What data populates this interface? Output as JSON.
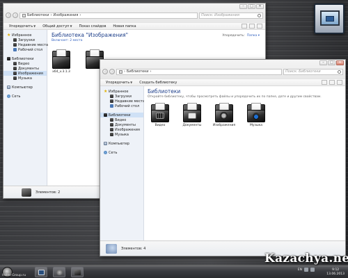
{
  "window_back": {
    "address": [
      "Библиотеки",
      "Изображения"
    ],
    "search_placeholder": "Поиск: Изображения",
    "toolbar": [
      "Упорядочить",
      "Общий доступ",
      "Показ слайдов",
      "Новая папка"
    ],
    "nav": {
      "favorites": {
        "label": "Избранное",
        "items": [
          "Загрузки",
          "Недавние места",
          "Рабочий стол"
        ]
      },
      "libraries": {
        "label": "Библиотеки",
        "items": [
          "Видео",
          "Документы",
          "Изображения",
          "Музыка"
        ]
      },
      "computer": "Компьютер",
      "network": "Сеть"
    },
    "library_title": "Библиотека \"Изображения\"",
    "library_sub": "Включает: 2 места",
    "arrange_label": "Упорядочить:",
    "arrange_value": "Папка",
    "files": [
      {
        "name": "x64_v.3.1.3"
      },
      {
        "name": ""
      }
    ],
    "status": "Элементов: 2"
  },
  "window_front": {
    "address": [
      "Библиотеки"
    ],
    "search_placeholder": "Поиск: Библиотеки",
    "toolbar": [
      "Упорядочить",
      "Создать библиотеку"
    ],
    "nav": {
      "favorites": {
        "label": "Избранное",
        "items": [
          "Загрузки",
          "Недавние места",
          "Рабочий стол"
        ]
      },
      "libraries": {
        "label": "Библиотеки",
        "items": [
          "Видео",
          "Документы",
          "Изображения",
          "Музыка"
        ]
      },
      "computer": "Компьютер",
      "network": "Сеть"
    },
    "library_title": "Библиотеки",
    "library_sub": "Откройте библиотеку, чтобы просмотреть файлы и упорядочить их по папке, дате и другим свойствам.",
    "files": [
      {
        "name": "Видео",
        "icon": "video-library-icon"
      },
      {
        "name": "Документы",
        "icon": "documents-library-icon"
      },
      {
        "name": "Изображения",
        "icon": "pictures-library-icon"
      },
      {
        "name": "Музыка",
        "icon": "music-library-icon"
      }
    ],
    "status": "Элементов: 4"
  },
  "taskbar": {
    "site_label": "Holes-Group.ru",
    "lang": "EN",
    "time": "9:12",
    "date": "13.06.2013"
  },
  "watermark": "Kazachya.net",
  "colors": {
    "library_title": "#1e3f8a",
    "link": "#2f5fbf",
    "nav_bg": "#eef2f8",
    "selected": "#cfe1f6"
  }
}
